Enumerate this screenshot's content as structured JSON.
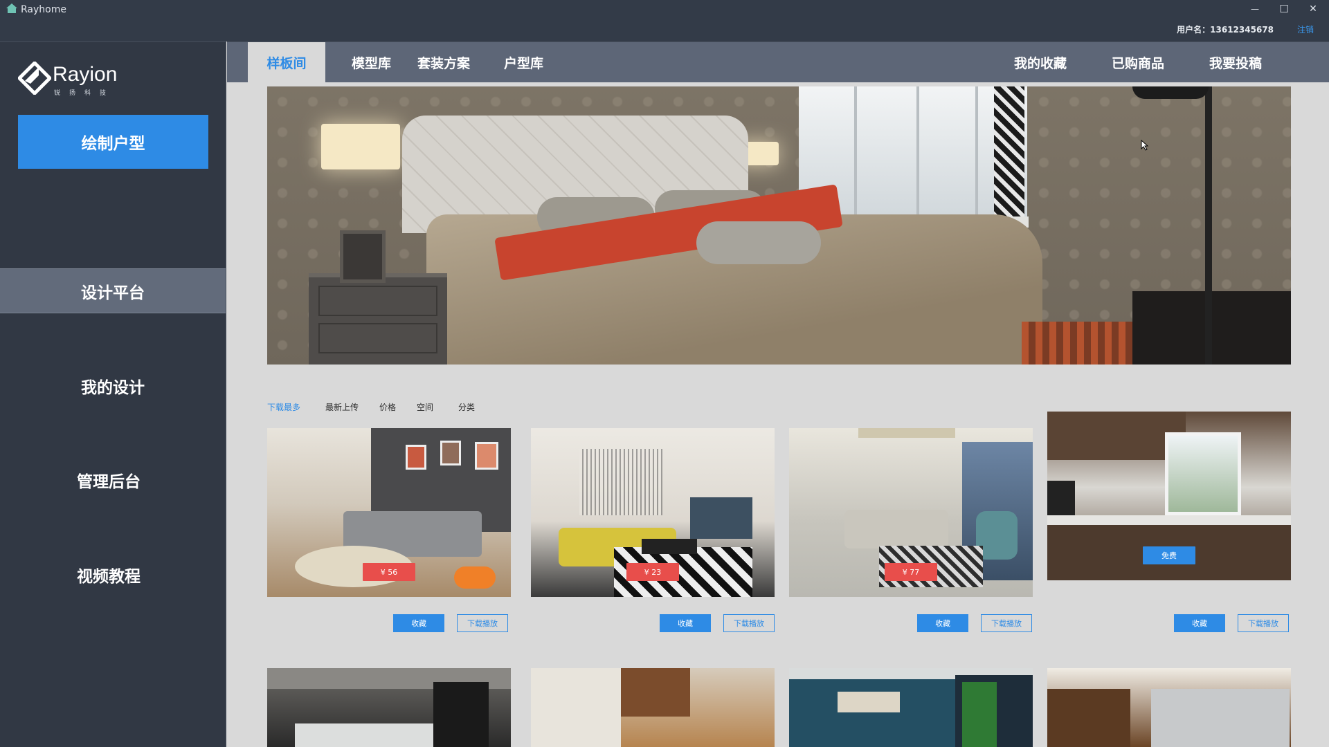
{
  "app": {
    "title": "Rayhome"
  },
  "window_controls": {
    "minimize": "—",
    "maximize": "☐",
    "close": "✕"
  },
  "user": {
    "label": "用户名：13612345678",
    "logout": "注销"
  },
  "logo": {
    "word": "Rayion",
    "sub": "锐扬科技"
  },
  "sidebar": {
    "draw_button": "绘制户型",
    "items": [
      {
        "label": "设计平台",
        "active": true
      },
      {
        "label": "我的设计"
      },
      {
        "label": "管理后台"
      },
      {
        "label": "视频教程"
      }
    ]
  },
  "tabs": {
    "left": [
      "样板间",
      "模型库",
      "套装方案",
      "户型库"
    ],
    "right": [
      "我的收藏",
      "已购商品",
      "我要投稿"
    ]
  },
  "filters": [
    "下载最多",
    "最新上传",
    "价格",
    "空间",
    "分类"
  ],
  "cards": [
    {
      "price": "¥ 56",
      "fav": "收藏",
      "download": "下载播放"
    },
    {
      "price": "¥ 23",
      "fav": "收藏",
      "download": "下载播放"
    },
    {
      "price": "¥ 77",
      "fav": "收藏",
      "download": "下载播放"
    },
    {
      "price": "免费",
      "fav": "收藏",
      "download": "下载播放"
    }
  ],
  "colors": {
    "accent": "#2e8be5",
    "price_red": "#e84e4b",
    "sidebar": "#313844",
    "tabbar": "#5d6677"
  },
  "icons": {
    "app": "house-icon",
    "logo": "rayion-logo-icon"
  }
}
